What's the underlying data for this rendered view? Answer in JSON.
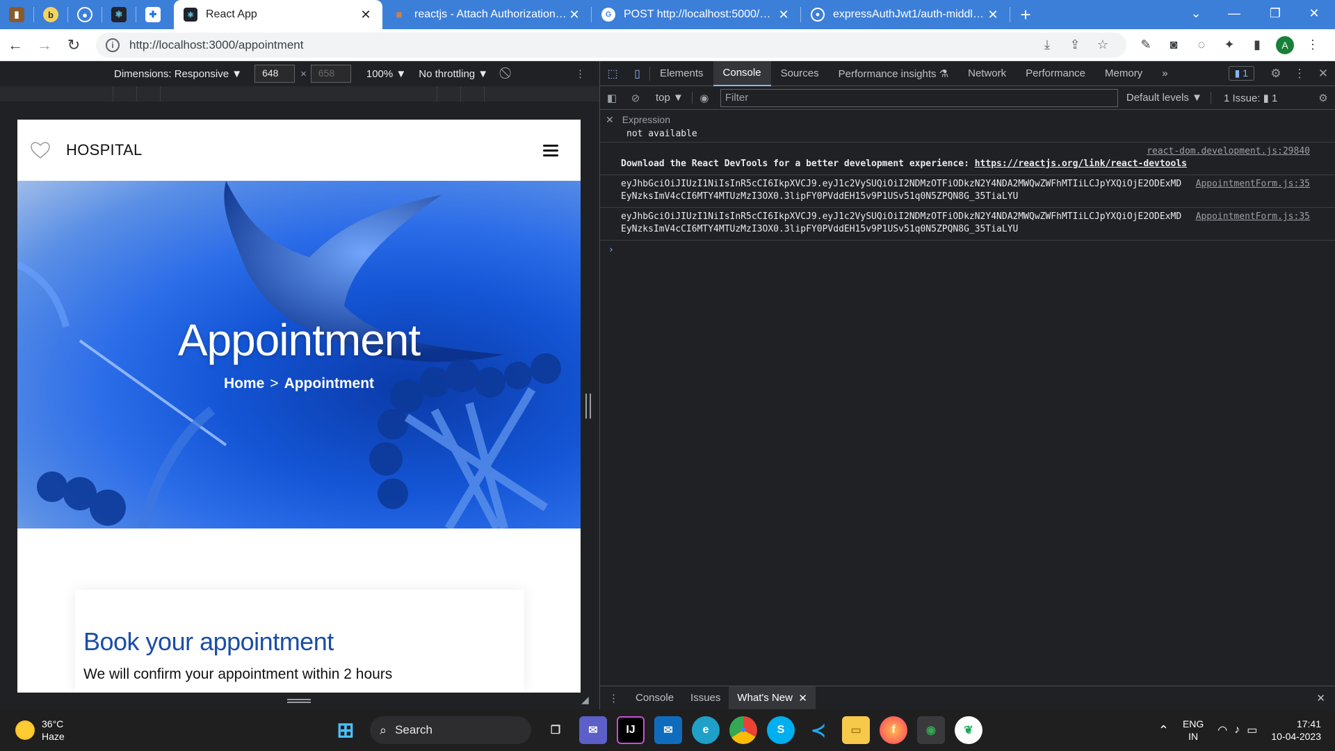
{
  "browser": {
    "tabs": [
      {
        "title": "React App",
        "active": true
      },
      {
        "title": "reactjs - Attach Authorization he",
        "active": false
      },
      {
        "title": "POST http://localhost:5000/app/",
        "active": false
      },
      {
        "title": "expressAuthJwt1/auth-middlewa",
        "active": false
      }
    ],
    "url": "http://localhost:3000/appointment",
    "profile_initial": "A"
  },
  "device_toolbar": {
    "dimensions": "Dimensions: Responsive ▼",
    "width": "648",
    "height": "658",
    "times": "×",
    "zoom": "100% ▼",
    "throttling": "No throttling ▼"
  },
  "site": {
    "brand": "HOSPITAL",
    "hero_title": "Appointment",
    "breadcrumb_home": "Home",
    "breadcrumb_sep": ">",
    "breadcrumb_current": "Appointment",
    "booking_title": "Book your appointment",
    "booking_subtitle": "We will confirm your appointment within 2 hours"
  },
  "devtools": {
    "tabs": [
      "Elements",
      "Console",
      "Sources",
      "Performance insights ⚗",
      "Network",
      "Performance",
      "Memory"
    ],
    "more": "»",
    "issue_badge": "▮ 1",
    "context": "top ▼",
    "filter_placeholder": "Filter",
    "levels": "Default levels ▼",
    "issues_label": "1 Issue: ▮ 1",
    "expression_label": "Expression",
    "expression_value": "not available",
    "messages": {
      "m1_src": "react-dom.development.js:29840",
      "m1_text": "Download the React DevTools for a better development experience: ",
      "m1_link": "https://reactjs.org/link/react-devtools",
      "m2_src": "AppointmentForm.js:35",
      "m2_text": "eyJhbGciOiJIUzI1NiIsInR5cCI6IkpXVCJ9.eyJ1c2VySUQiOiI2NDMzOTFiODkzN2Y4NDA2MWQwZWFhMTIiLCJpYXQiOjE2ODExMDEyNzksImV4cCI6MTY4MTUzMzI3OX0.3lipFY0PVddEH15v9P1USv51q0N5ZPQN8G_35TiaLYU",
      "m3_src": "AppointmentForm.js:35",
      "m3_text": "eyJhbGciOiJIUzI1NiIsInR5cCI6IkpXVCJ9.eyJ1c2VySUQiOiI2NDMzOTFiODkzN2Y4NDA2MWQwZWFhMTIiLCJpYXQiOjE2ODExMDEyNzksImV4cCI6MTY4MTUzMzI3OX0.3lipFY0PVddEH15v9P1USv51q0N5ZPQN8G_35TiaLYU"
    },
    "prompt": "›",
    "drawer_tabs": [
      "Console",
      "Issues",
      "What's New"
    ]
  },
  "taskbar": {
    "temp": "36°C",
    "condition": "Haze",
    "search": "Search",
    "lang1": "ENG",
    "lang2": "IN",
    "time": "17:41",
    "date": "10-04-2023"
  },
  "colors": {
    "chrome_blue": "#3c7fd9",
    "devtools_bg": "#202124",
    "booking_title": "#1a4da8"
  }
}
